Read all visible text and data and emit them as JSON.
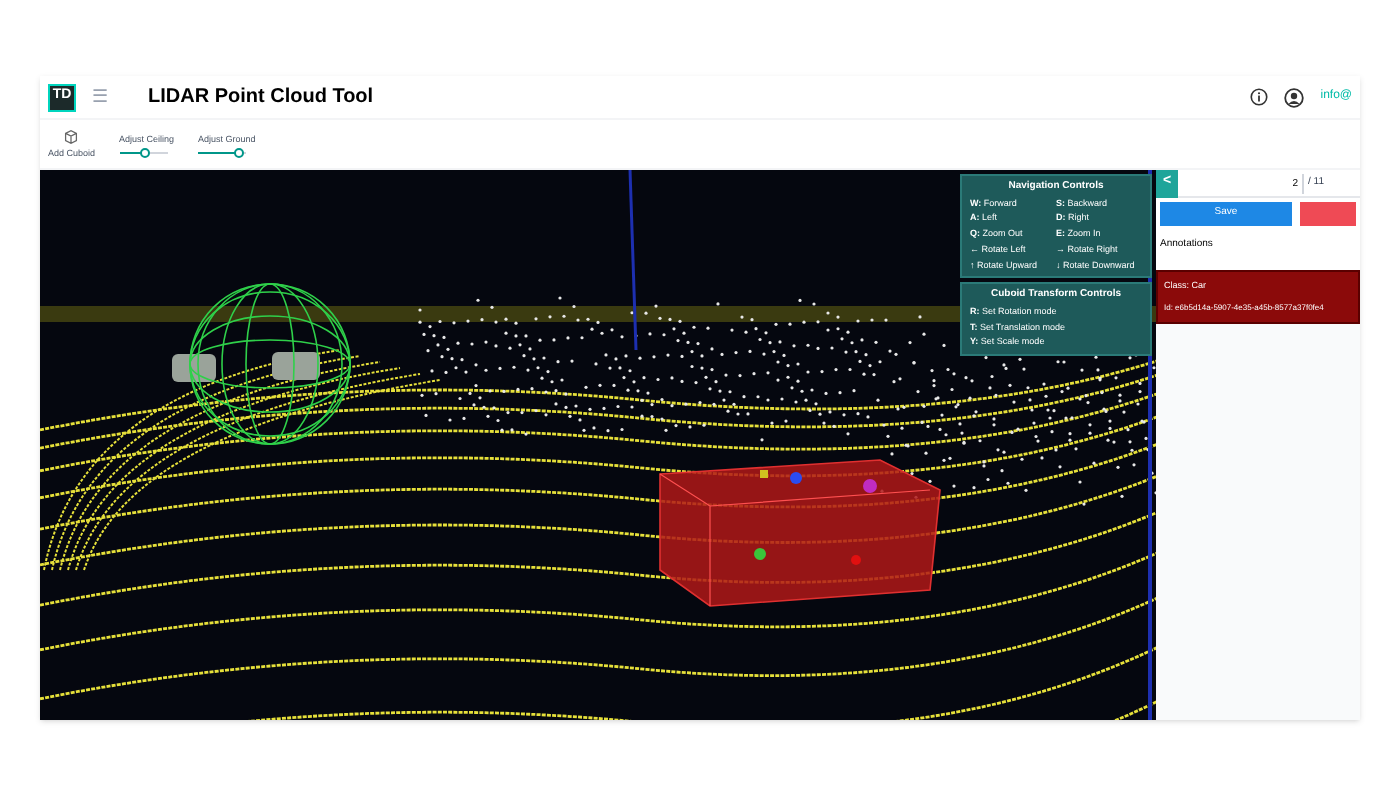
{
  "header": {
    "logo": "TD",
    "menu_icon": "☰",
    "title": "LIDAR Point Cloud Tool",
    "user": "info@"
  },
  "toolbar": {
    "add_button": "Add Cuboid",
    "sliders": [
      {
        "label": "Adjust Ceiling",
        "level": 0.55
      },
      {
        "label": "Adjust Ground",
        "level": 0.85
      }
    ]
  },
  "navigation_controls": {
    "title": "Navigation Controls",
    "items": [
      {
        "key": "W:",
        "action": "Forward"
      },
      {
        "key": "S:",
        "action": "Backward"
      },
      {
        "key": "A:",
        "action": "Left"
      },
      {
        "key": "D:",
        "action": "Right"
      },
      {
        "key": "Q:",
        "action": "Zoom Out"
      },
      {
        "key": "E:",
        "action": "Zoom In"
      },
      {
        "key": "←",
        "action": "Rotate Left"
      },
      {
        "key": "→",
        "action": "Rotate Right"
      },
      {
        "key": "↑",
        "action": "Rotate Upward"
      },
      {
        "key": "↓",
        "action": "Rotate Downward"
      }
    ]
  },
  "cuboid_controls": {
    "title": "Cuboid Transform Controls",
    "items": [
      {
        "key": "R:",
        "action": "Set Rotation mode"
      },
      {
        "key": "T:",
        "action": "Set Translation mode"
      },
      {
        "key": "Y:",
        "action": "Set Scale mode"
      }
    ]
  },
  "sidebar": {
    "back": "<",
    "frame": "2",
    "total": "/ 11",
    "save": "Save",
    "annotations_label": "Annotations",
    "annotations": [
      {
        "class": "Class: Car",
        "id": "Id: e6b5d14a-5907-4e35-a45b-8577a37f0fe4",
        "selected": true
      }
    ]
  }
}
